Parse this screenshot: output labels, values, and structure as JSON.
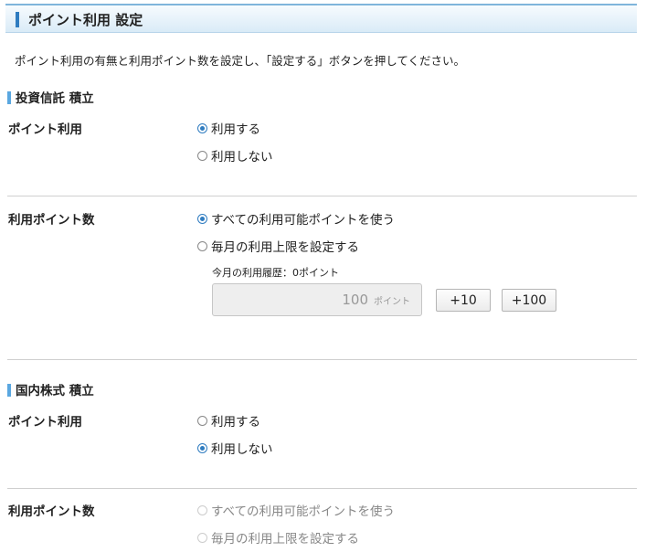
{
  "header": {
    "title": "ポイント利用 設定"
  },
  "intro": "ポイント利用の有無と利用ポイント数を設定し、「設定する」ボタンを押してください。",
  "sections": [
    {
      "title": "投資信託 積立",
      "usage_label": "ポイント利用",
      "usage_options": [
        "利用する",
        "利用しない"
      ],
      "usage_selected": "利用する",
      "amount_label": "利用ポイント数",
      "amount_options": [
        "すべての利用可能ポイントを使う",
        "毎月の利用上限を設定する"
      ],
      "amount_selected": "すべての利用可能ポイントを使う",
      "history": "今月の利用履歴：0ポイント",
      "input_value": "100",
      "input_unit": "ポイント",
      "buttons": [
        "+10",
        "+100"
      ]
    },
    {
      "title": "国内株式 積立",
      "usage_label": "ポイント利用",
      "usage_options": [
        "利用する",
        "利用しない"
      ],
      "usage_selected": "利用しない",
      "amount_label": "利用ポイント数",
      "amount_options": [
        "すべての利用可能ポイントを使う",
        "毎月の利用上限を設定する"
      ],
      "amount_state": "disabled"
    }
  ],
  "colors": {
    "accent": "#2f7cc0",
    "header_bg": "#d9ebf7"
  }
}
